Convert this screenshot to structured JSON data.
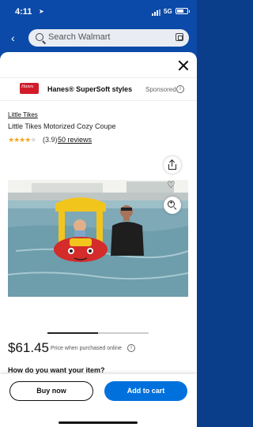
{
  "status_bar": {
    "time": "4:11",
    "network": "5G",
    "location_glyph": "➤"
  },
  "header": {
    "search_placeholder": "Search Walmart",
    "back_glyph": "‹"
  },
  "sponsored": {
    "logo_text": "Hanes",
    "brand": "Hanes® SuperSoft styles",
    "label": "Sponsored",
    "info_glyph": "i"
  },
  "product": {
    "brand_link": "Little Tikes",
    "title": "Little Tikes Motorized Cozy Coupe",
    "stars_full": "★★★★",
    "stars_half": "★",
    "rating": 3.9,
    "rating_text": "(3.9)",
    "reviews_text": "50 reviews",
    "heart_glyph": "♡"
  },
  "price": {
    "amount": "$61.45",
    "note": "Price when purchased online",
    "info_glyph": "i"
  },
  "fulfillment": {
    "heading": "How do you want your item?"
  },
  "carousel": {
    "current_fraction": 0.5
  },
  "actions": {
    "buy_now": "Buy now",
    "add_to_cart": "Add to cart"
  },
  "colors": {
    "header_blue": "#0b4aa8",
    "cart_blue": "#0071dc",
    "star": "#f5a623",
    "hanes_red": "#d11b2b"
  }
}
